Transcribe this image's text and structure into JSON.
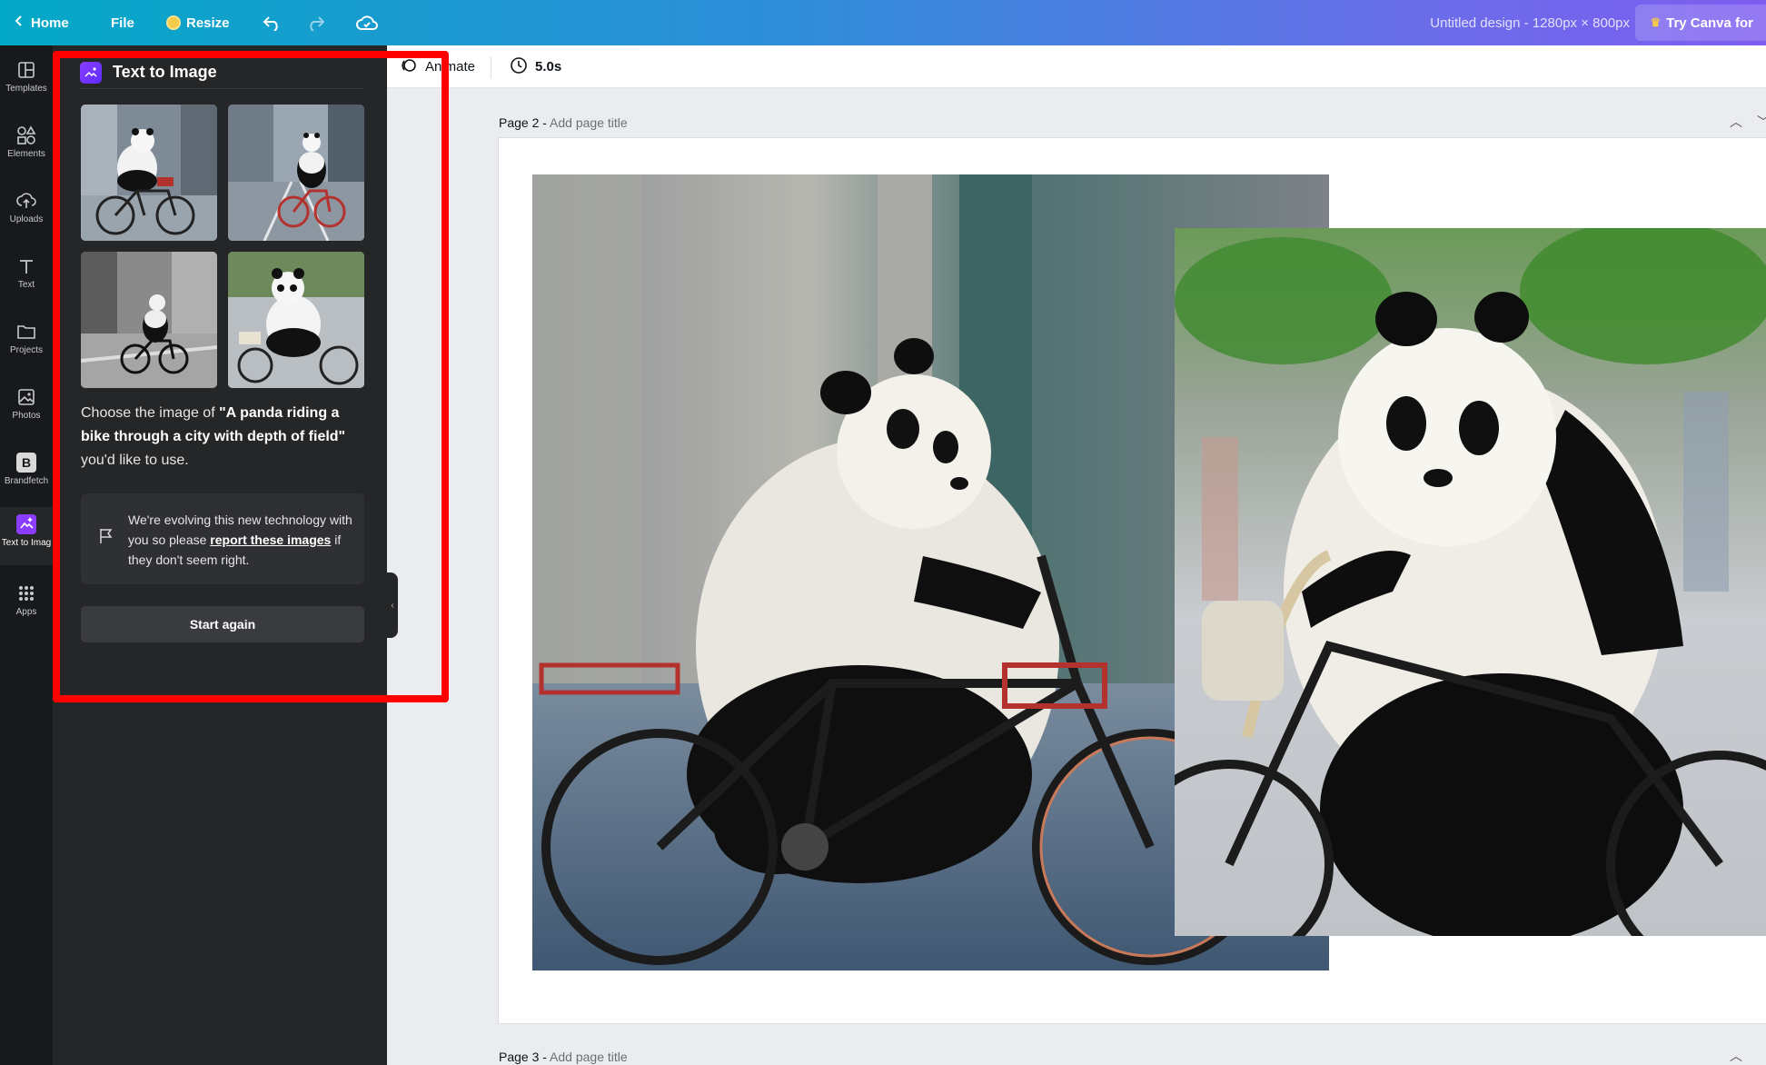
{
  "topbar": {
    "home_label": "Home",
    "file_label": "File",
    "resize_label": "Resize",
    "design_title": "Untitled design - 1280px × 800px",
    "try_label": "Try Canva for"
  },
  "rail": {
    "items": [
      {
        "label": "Templates"
      },
      {
        "label": "Elements"
      },
      {
        "label": "Uploads"
      },
      {
        "label": "Text"
      },
      {
        "label": "Projects"
      },
      {
        "label": "Photos"
      },
      {
        "label": "Brandfetch"
      },
      {
        "label": "Text to Imag"
      },
      {
        "label": "Apps"
      }
    ]
  },
  "panel": {
    "title": "Text to Image",
    "choose_prefix": "Choose the image of ",
    "prompt": "\"A panda riding a bike through a city with depth of field\"",
    "choose_suffix": " you'd like to use.",
    "notice_pre": "We're evolving this new technology with you so please ",
    "notice_link": "report these images",
    "notice_post": " if they don't seem right.",
    "start_again": "Start again"
  },
  "toolbar": {
    "animate_label": "Animate",
    "duration_label": "5.0s"
  },
  "pages": {
    "page2": {
      "number": "Page 2 - ",
      "title_placeholder": "Add page title"
    },
    "page3": {
      "number": "Page 3 - ",
      "title_placeholder": "Add page title"
    }
  },
  "colors": {
    "accent": "#8b3dff",
    "annotation": "#ff0000",
    "panel_bg": "#252627",
    "rail_bg": "#18191b"
  }
}
